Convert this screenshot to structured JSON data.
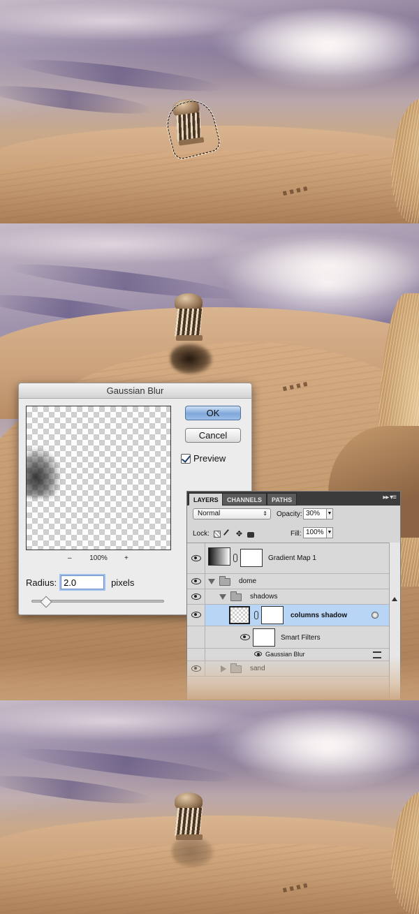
{
  "gaussian_blur": {
    "title": "Gaussian Blur",
    "ok_label": "OK",
    "cancel_label": "Cancel",
    "preview_label": "Preview",
    "preview_checked": true,
    "zoom_minus": "–",
    "zoom_value": "100%",
    "zoom_plus": "+",
    "radius_label": "Radius:",
    "radius_value": "2.0",
    "radius_unit": "pixels"
  },
  "layers_panel": {
    "tabs": [
      "LAYERS",
      "CHANNELS",
      "PATHS"
    ],
    "menu_icon": "panel-menu-icon",
    "blend_mode": "Normal",
    "opacity_label": "Opacity:",
    "opacity_value": "30%",
    "lock_label": "Lock:",
    "fill_label": "Fill:",
    "fill_value": "100%",
    "layers": {
      "gradient_map": "Gradient Map 1",
      "dome": "dome",
      "shadows": "shadows",
      "columns_shadow": "columns shadow",
      "smart_filters": "Smart Filters",
      "gaussian_blur": "Gaussian Blur",
      "sand": "sand"
    }
  }
}
